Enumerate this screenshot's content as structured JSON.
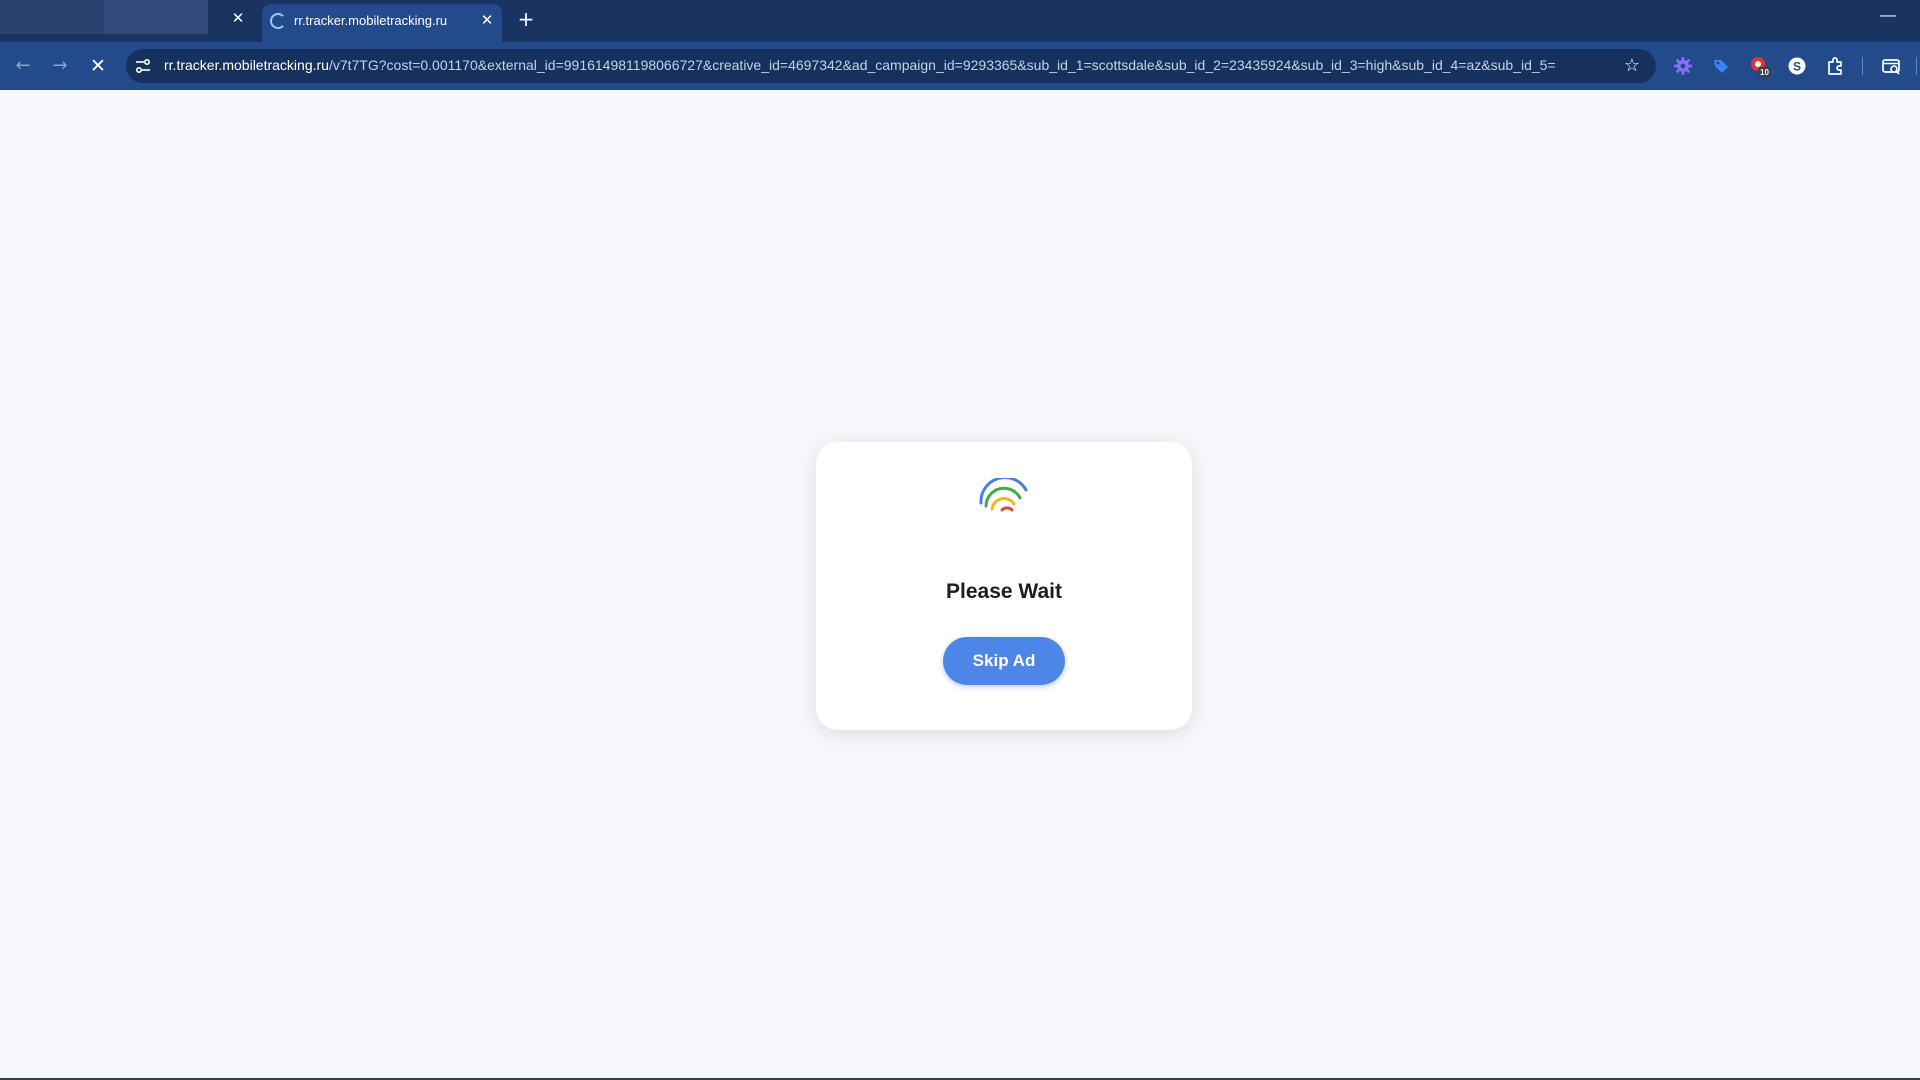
{
  "browser": {
    "tabs": [
      {
        "title": "",
        "state": "inactive"
      },
      {
        "title": "rr.tracker.mobiletracking.ru",
        "state": "active",
        "loading": true
      }
    ],
    "new_tab_symbol": "+",
    "close_symbol": "✕",
    "minimize_symbol": "—",
    "address_bar": {
      "host": "rr.tracker.mobiletracking.ru",
      "path": "/v7t7TG?cost=0.001170&external_id=991614981198066727&creative_id=4697342&ad_campaign_id=9293365&sub_id_1=scottsdale&sub_id_2=23435924&sub_id_3=high&sub_id_4=az&sub_id_5="
    },
    "extensions": [
      {
        "icon": "gear-puzzle-icon",
        "color": "#8a6cff"
      },
      {
        "icon": "tag-icon",
        "color": "#3b82f6"
      },
      {
        "icon": "record-icon",
        "color": "#e0362d",
        "badge": "10"
      },
      {
        "icon": "s-coin-icon",
        "color": "#ffffff"
      },
      {
        "icon": "puzzle-icon",
        "color": "#ffffff"
      },
      {
        "icon": "tab-search-icon",
        "color": "#ffffff"
      }
    ]
  },
  "page": {
    "dialog": {
      "title": "Please Wait",
      "button_label": "Skip Ad"
    },
    "colors": {
      "background": "#f6f7fb",
      "button": "#4e86e8",
      "arc_blue": "#4a7fe3",
      "arc_green": "#44a84c",
      "arc_yellow": "#f2b51e",
      "arc_red": "#e0463a"
    }
  }
}
